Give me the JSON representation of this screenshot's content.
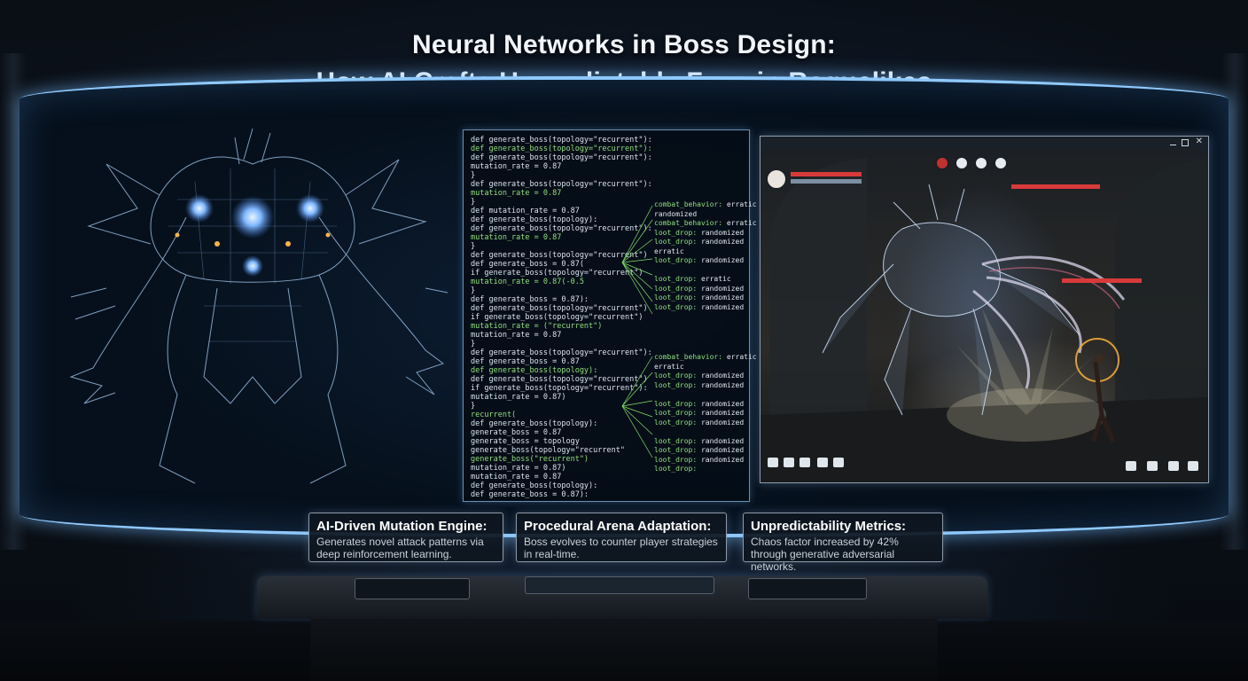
{
  "title": {
    "line1": "Neural Networks in Boss Design:",
    "line2": "How AI Crafts Unpredictable Foes in Roguelikes"
  },
  "code_panel": {
    "lines": [
      "def generate_boss(topology=\"recurrent\"):",
      "  def generate_boss(topology=\"recurrent\"):",
      "    def generate_boss(topology=\"recurrent\"):",
      "      mutation_rate = 0.87",
      "  }",
      "  def generate_boss(topology=\"recurrent\"):",
      "    mutation_rate = 0.87",
      "  }",
      "  def mutation_rate = 0.87",
      "  def generate_boss(topology):",
      "    def generate_boss(topology=\"recurrent\"):",
      "      mutation_rate = 0.87",
      "  }",
      "  def generate_boss(topology=\"recurrent\")",
      "    def generate_boss = 0.87(",
      "      if generate_boss(topology=\"recurrent\")",
      "      mutation_rate = 0.87(-0.5",
      "  }",
      "  def generate_boss = 0.87):",
      "  def generate_boss(topology=\"recurrent\")",
      "    if generate_boss(topology=\"recurrent\")",
      "      mutation_rate = (\"recurrent\")",
      "    mutation_rate = 0.87",
      "  }",
      "def generate_boss(topology=\"recurrent\"):",
      "  def generate_boss = 0.87",
      "  def generate_boss(topology):",
      "  def generate_boss(topology=\"recurrent\")",
      "    if generate_boss(topology=\"recurrent\"):",
      "      mutation_rate = 0.87)",
      "  }",
      "recurrent(",
      "  def generate_boss(topology):",
      "    generate_boss = 0.87",
      "    generate_boss = topology",
      "    generate_boss(topology=\"recurrent\"",
      "      generate_boss(\"recurrent\")",
      "      mutation_rate = 0.87)",
      "      mutation_rate = 0.87",
      "  def generate_boss(topology):",
      "def generate_boss = 0.87):"
    ],
    "annotations_top": [
      {
        "key": "combat_behavior:",
        "val": "erratic"
      },
      {
        "key": "",
        "val": "randomized"
      },
      {
        "key": "combat_behavior:",
        "val": "erratic"
      },
      {
        "key": "loot_drop:",
        "val": "randomized"
      },
      {
        "key": "loot_drop:",
        "val": "randomized"
      },
      {
        "key": "",
        "val": "erratic"
      },
      {
        "key": "loot_drop:",
        "val": "randomized"
      },
      {
        "key": "",
        "val": ""
      },
      {
        "key": "loot_drop:",
        "val": "erratic"
      },
      {
        "key": "loot_drop:",
        "val": "randomized"
      },
      {
        "key": "loot_drop:",
        "val": "randomized"
      },
      {
        "key": "loot_drop:",
        "val": "randomized"
      }
    ],
    "annotations_bottom": [
      {
        "key": "combat_behavior:",
        "val": "erratic"
      },
      {
        "key": "",
        "val": "erratic"
      },
      {
        "key": "loot_drop:",
        "val": "randomized"
      },
      {
        "key": "loot_drop:",
        "val": "randomized"
      },
      {
        "key": "",
        "val": ""
      },
      {
        "key": "loot_drop:",
        "val": "randomized"
      },
      {
        "key": "loot_drop:",
        "val": "randomized"
      },
      {
        "key": "loot_drop:",
        "val": "randomized"
      },
      {
        "key": "",
        "val": ""
      },
      {
        "key": "loot_drop:",
        "val": "randomized"
      },
      {
        "key": "loot_drop:",
        "val": "randomized"
      },
      {
        "key": "loot_drop:",
        "val": "randomized"
      },
      {
        "key": "loot_drop:",
        "val": ""
      }
    ]
  },
  "cards": [
    {
      "title": "AI-Driven Mutation Engine:",
      "body": "Generates novel attack patterns via deep reinforcement learning."
    },
    {
      "title": "Procedural Arena Adaptation:",
      "body": "Boss evolves to counter player strategies in real-time."
    },
    {
      "title": "Unpredictability Metrics:",
      "body": "Chaos factor increased by 42% through generative adversarial networks."
    }
  ],
  "colors": {
    "screen_glow": "#8ec9ff",
    "code_keyword": "#8fe07d",
    "health_red": "#d83a3a"
  },
  "icons": {
    "window_controls": [
      "minimize-icon",
      "maximize-icon",
      "close-icon"
    ]
  }
}
